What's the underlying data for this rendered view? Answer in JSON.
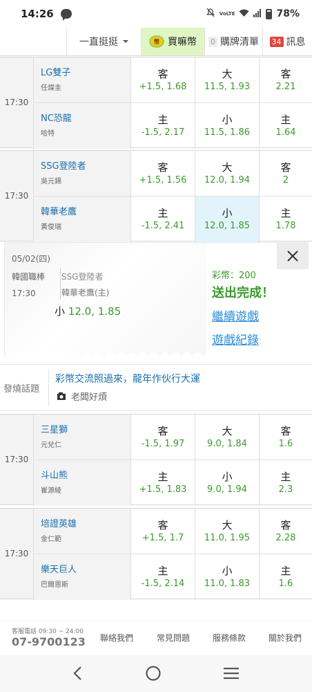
{
  "status_bar": {
    "time": "14:26",
    "battery": "78%",
    "lte_label": "VoLTE"
  },
  "nav": {
    "sort_label": "一直挺挺",
    "buy_label": "買嘛幣",
    "cart_label": "購牌清單",
    "cart_count": "0",
    "msg_label": "訊息",
    "msg_count": "34"
  },
  "games": [
    {
      "time": "17:30",
      "away": {
        "name": "LG雙子",
        "pitcher": "任燦圭"
      },
      "home": {
        "name": "NC恐龍",
        "pitcher": "哈特"
      },
      "spread": {
        "away_side": "客",
        "away": "+1.5, 1.68",
        "home_side": "主",
        "home": "-1.5, 2.17"
      },
      "total": {
        "over_side": "大",
        "over": "11.5, 1.93",
        "under_side": "小",
        "under": "11.5, 1.86"
      },
      "moneyline": {
        "away_side": "客",
        "away": "2.21",
        "home_side": "主",
        "home": "1.64"
      }
    },
    {
      "time": "17:30",
      "away": {
        "name": "SSG登陸者",
        "pitcher": "吳元錫"
      },
      "home": {
        "name": "韓華老鷹",
        "pitcher": "黃俊瑞"
      },
      "spread": {
        "away_side": "客",
        "away": "+1.5, 1.56",
        "home_side": "主",
        "home": "-1.5, 2.41"
      },
      "total": {
        "over_side": "大",
        "over": "12.0, 1.94",
        "under_side": "小",
        "under": "12.0, 1.85"
      },
      "moneyline": {
        "away_side": "客",
        "away": "2",
        "home_side": "主",
        "home": "1.78"
      }
    },
    {
      "time": "17:30",
      "away": {
        "name": "三星獅",
        "pitcher": "元兌仁"
      },
      "home": {
        "name": "斗山熊",
        "pitcher": "崔源綾"
      },
      "spread": {
        "away_side": "客",
        "away": "-1.5, 1.97",
        "home_side": "主",
        "home": "+1.5, 1.83"
      },
      "total": {
        "over_side": "大",
        "over": "9.0, 1.84",
        "under_side": "小",
        "under": "9.0, 1.94"
      },
      "moneyline": {
        "away_side": "客",
        "away": "1.6",
        "home_side": "主",
        "home": "2.3"
      }
    },
    {
      "time": "17:30",
      "away": {
        "name": "培證英雄",
        "pitcher": "金仁範"
      },
      "home": {
        "name": "樂天巨人",
        "pitcher": "巴爾恩斯"
      },
      "spread": {
        "away_side": "客",
        "away": "+1.5, 1.7",
        "home_side": "主",
        "home": "-1.5, 2.14"
      },
      "total": {
        "over_side": "大",
        "over": "11.0, 1.95",
        "under_side": "小",
        "under": "11.0, 1.83"
      },
      "moneyline": {
        "away_side": "客",
        "away": "2.28",
        "home_side": "主",
        "home": "1.6"
      }
    }
  ],
  "bet_panel": {
    "date": "05/02(四)",
    "league": "韓國職棒",
    "time": "17:30",
    "away": "SSG登陸者",
    "home": "韓華老鷹(主)",
    "pick_side": "小",
    "pick_value": "12.0, 1.85",
    "coins": "彩幣：200",
    "status": "送出完成！",
    "continue_link": "繼續遊戲",
    "history_link": "遊戲紀錄"
  },
  "topic": {
    "label": "發燒話題",
    "title": "彩幣交流照過來，龍年作伙行大運",
    "author": "老闆好煩"
  },
  "footer": {
    "service_label": "客服電話 09:30 ~ 24:00",
    "phone": "07-9700123",
    "links": [
      "聯絡我們",
      "常見問題",
      "服務條款",
      "關於我們"
    ]
  }
}
